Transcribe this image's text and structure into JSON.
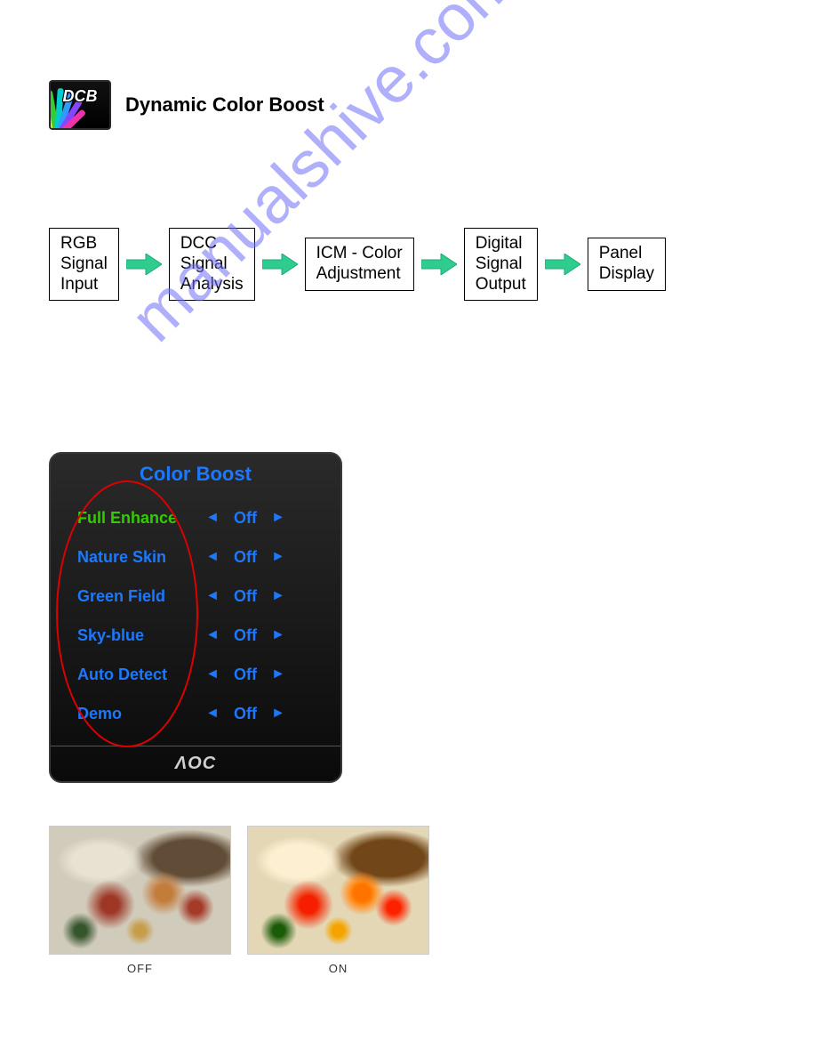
{
  "header": {
    "icon_label": "DCB",
    "title": "Dynamic Color Boost"
  },
  "flow": {
    "boxes": [
      "RGB\nSignal\nInput",
      "DCC\nSignal\nAnalysis",
      "ICM - Color\nAdjustment",
      "Digital\nSignal\nOutput",
      "Panel\nDisplay"
    ]
  },
  "osd": {
    "title": "Color Boost",
    "brand": "ΛOC",
    "items": [
      {
        "label": "Full Enhance",
        "value": "Off",
        "active": true
      },
      {
        "label": "Nature Skin",
        "value": "Off",
        "active": false
      },
      {
        "label": "Green Field",
        "value": "Off",
        "active": false
      },
      {
        "label": "Sky-blue",
        "value": "Off",
        "active": false
      },
      {
        "label": "Auto Detect",
        "value": "Off",
        "active": false
      },
      {
        "label": "Demo",
        "value": "Off",
        "active": false
      }
    ],
    "arrow_left": "◄",
    "arrow_right": "►"
  },
  "compare": {
    "off_label": "OFF",
    "on_label": "ON"
  },
  "watermark": "manualshive.com"
}
